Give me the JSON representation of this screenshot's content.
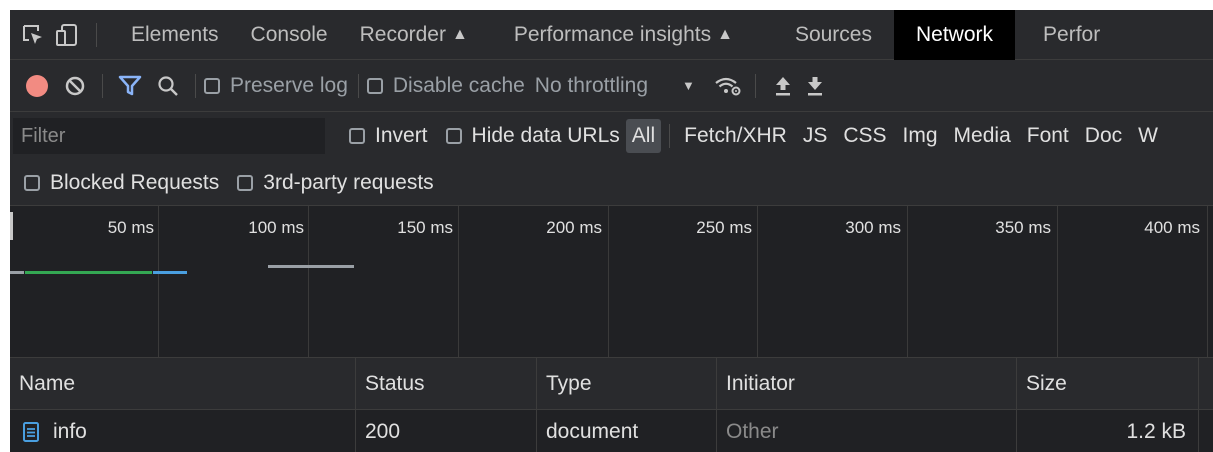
{
  "tabs": [
    {
      "label": "Elements",
      "experimental": false,
      "active": false
    },
    {
      "label": "Console",
      "experimental": false,
      "active": false
    },
    {
      "label": "Recorder",
      "experimental": true,
      "active": false
    },
    {
      "label": "Performance insights",
      "experimental": true,
      "active": false
    },
    {
      "label": "Sources",
      "experimental": false,
      "active": false
    },
    {
      "label": "Network",
      "experimental": false,
      "active": true
    },
    {
      "label": "Perfor",
      "experimental": false,
      "active": false
    }
  ],
  "toolbar": {
    "preserve_log_label": "Preserve log",
    "disable_cache_label": "Disable cache",
    "throttling_value": "No throttling",
    "record_color": "#f28b82",
    "filter_icon_color": "#8ab4f8"
  },
  "filterbar": {
    "placeholder": "Filter",
    "invert_label": "Invert",
    "hide_data_urls_label": "Hide data URLs",
    "types": [
      "All",
      "Fetch/XHR",
      "JS",
      "CSS",
      "Img",
      "Media",
      "Font",
      "Doc",
      "W"
    ],
    "active_type": "All"
  },
  "blockedbar": {
    "blocked_label": "Blocked Requests",
    "third_party_label": "3rd-party requests"
  },
  "overview": {
    "ticks": [
      "50 ms",
      "100 ms",
      "150 ms",
      "200 ms",
      "250 ms",
      "300 ms",
      "350 ms",
      "400 ms"
    ],
    "bar_colors": {
      "green": "#34a853",
      "blue": "#4a9fe0",
      "gray": "#9aa0a6"
    }
  },
  "table": {
    "headers": [
      "Name",
      "Status",
      "Type",
      "Initiator",
      "Size"
    ],
    "rows": [
      {
        "name": "info",
        "status": "200",
        "type": "document",
        "initiator": "Other",
        "size": "1.2 kB"
      }
    ]
  }
}
